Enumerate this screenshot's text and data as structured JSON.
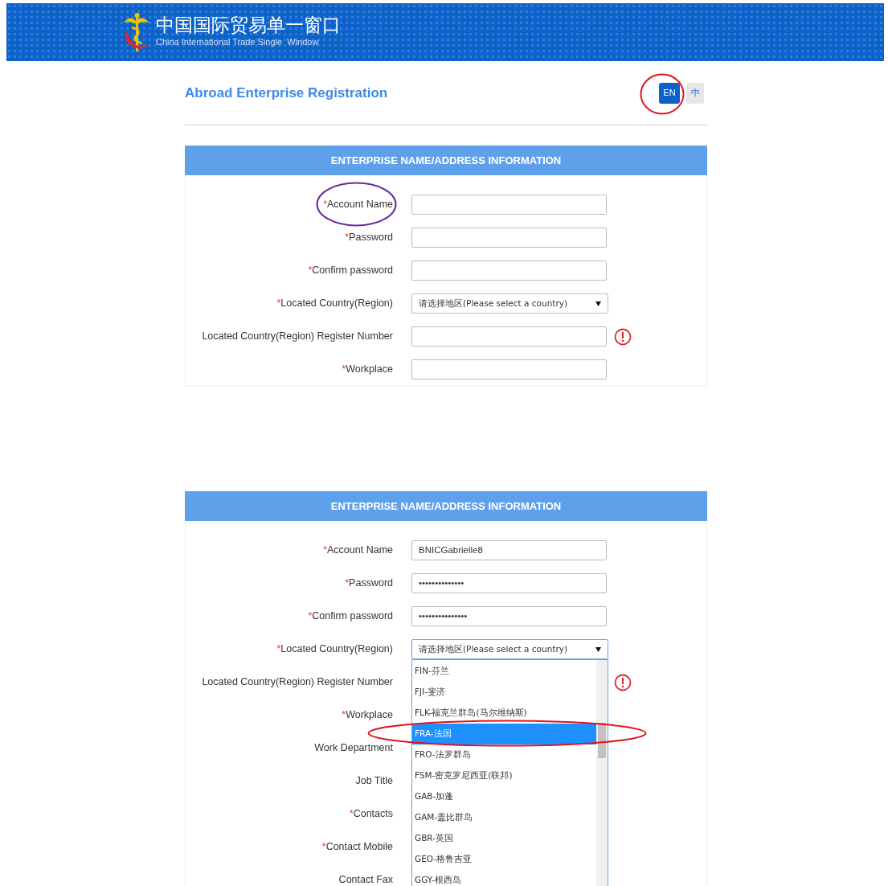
{
  "header": {
    "title": "中国国际贸易单一窗口",
    "subtitle": "China International Trade Single  Window"
  },
  "screens": [
    {
      "page_title": "Abroad Enterprise Registration",
      "languages": [
        {
          "label": "EN",
          "selected": true,
          "circle": {
            "color": "#e0141e"
          }
        },
        {
          "label": "中",
          "selected": false
        }
      ],
      "section_title": "ENTERPRISE NAME/ADDRESS INFORMATION",
      "fields": [
        {
          "required_mark": "*",
          "label": "Account Name",
          "kind": "text",
          "circle": {
            "color": "#6a2c9c"
          }
        },
        {
          "required_mark": "*",
          "label": "Password",
          "kind": "text"
        },
        {
          "required_mark": "*",
          "label": "Confirm password",
          "kind": "text"
        },
        {
          "required_mark": "*",
          "label": "Located Country(Region)",
          "kind": "select",
          "value": "请选择地区(Please select a country)"
        },
        {
          "label": "Located Country(Region) Register Number",
          "kind": "text",
          "warning": true
        },
        {
          "required_mark": "*",
          "label": "Workplace",
          "kind": "text"
        }
      ]
    },
    {
      "section_title": "ENTERPRISE NAME/ADDRESS INFORMATION",
      "fields": [
        {
          "required_mark": "*",
          "label": "Account Name",
          "kind": "text",
          "value": "BNICGabrielle8"
        },
        {
          "required_mark": "*",
          "label": "Password",
          "kind": "text",
          "value": "••••••••••••••"
        },
        {
          "required_mark": "*",
          "label": "Confirm password",
          "kind": "text",
          "value": "•••••••••••••••"
        },
        {
          "required_mark": "*",
          "label": "Located Country(Region)",
          "kind": "select",
          "value": "请选择地区(Please select a country)",
          "expanded": true,
          "options": [
            {
              "label": "FIN-芬兰",
              "selected": false
            },
            {
              "label": "FJI-斐济",
              "selected": false
            },
            {
              "label": "FLK-福克兰群岛(马尔维纳斯)",
              "selected": false
            },
            {
              "label": "FRA-法国",
              "selected": true,
              "circle": {
                "color": "#e0141e"
              }
            },
            {
              "label": "FRO-法罗群岛",
              "selected": false
            },
            {
              "label": "FSM-密克罗尼西亚(联邦)",
              "selected": false
            },
            {
              "label": "GAB-加蓬",
              "selected": false
            },
            {
              "label": "GAM-盖比群岛",
              "selected": false
            },
            {
              "label": "GBR-英国",
              "selected": false
            },
            {
              "label": "GEO-格鲁吉亚",
              "selected": false
            },
            {
              "label": "GGY-根西岛",
              "selected": false
            }
          ]
        },
        {
          "label": "Located Country(Region) Register Number",
          "kind": "label",
          "warning": true
        },
        {
          "required_mark": "*",
          "label": "Workplace",
          "kind": "label"
        },
        {
          "label": "Work Department",
          "kind": "label"
        },
        {
          "label": "Job Title",
          "kind": "label"
        },
        {
          "required_mark": "*",
          "label": "Contacts",
          "kind": "label"
        },
        {
          "required_mark": "*",
          "label": "Contact Mobile",
          "kind": "label"
        },
        {
          "label": "Contact Fax",
          "kind": "label"
        }
      ]
    }
  ]
}
